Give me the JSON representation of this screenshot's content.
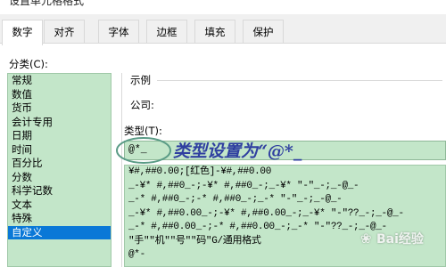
{
  "window": {
    "title": "设置单元格格式"
  },
  "tabs": [
    {
      "label": "数字",
      "active": true
    },
    {
      "label": "对齐",
      "active": false
    },
    {
      "label": "字体",
      "active": false
    },
    {
      "label": "边框",
      "active": false
    },
    {
      "label": "填充",
      "active": false
    },
    {
      "label": "保护",
      "active": false
    }
  ],
  "category": {
    "label": "分类(C):",
    "items": [
      "常规",
      "数值",
      "货币",
      "会计专用",
      "日期",
      "时间",
      "百分比",
      "分数",
      "科学记数",
      "文本",
      "特殊",
      "自定义"
    ],
    "selected": "自定义"
  },
  "sample": {
    "label": "示例",
    "value": "公司:"
  },
  "type": {
    "label": "类型(T):",
    "value": "@*_",
    "annotation": "类型设置为“@*_",
    "formats": [
      "¥#,##0.00;[红色]-¥#,##0.00",
      "_-¥* #,##0_-;-¥* #,##0_-;_-¥* \"-\"_-;_-@_-",
      "_-* #,##0_-;-* #,##0_-;_-* \"-\"_-;_-@_-",
      "_-¥* #,##0.00_-;-¥* #,##0.00_-;_-¥* \"-\"??_-;_-@_-",
      "_-* #,##0.00_-;-* #,##0.00_-;_-* \"-\"??_-;_-@_-",
      "\"手\"\"机\"\"号\"\"码\"G/通用格式",
      "@*-"
    ]
  },
  "watermark": {
    "text": "Bai经验"
  },
  "colors": {
    "list_bg": "#c3e6c9",
    "selection": "#0a78d7",
    "annotation": "#2f3fa0",
    "circle": "#5a9b86"
  }
}
